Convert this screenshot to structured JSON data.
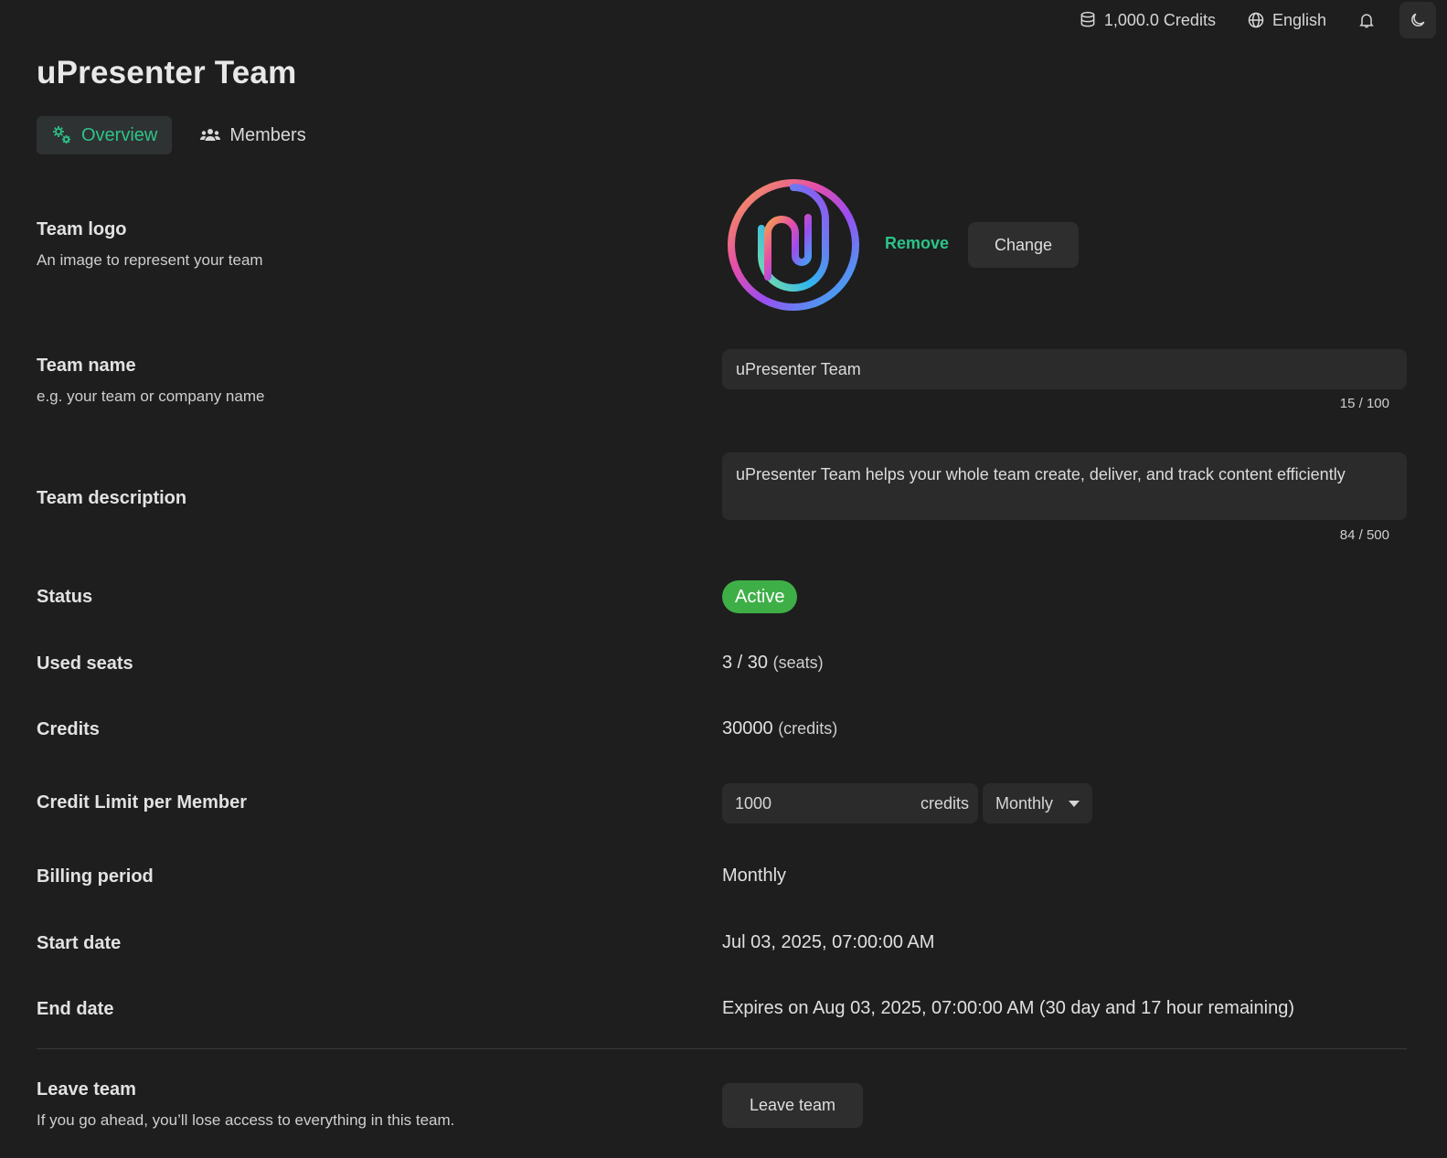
{
  "topbar": {
    "credits": "1,000.0 Credits",
    "language": "English"
  },
  "page_title": "uPresenter Team",
  "tabs": [
    {
      "label": "Overview",
      "active": true,
      "icon": "gears-icon"
    },
    {
      "label": "Members",
      "active": false,
      "icon": "users-icon"
    }
  ],
  "team_logo": {
    "title": "Team logo",
    "subtitle": "An image to represent your team",
    "remove_label": "Remove",
    "change_label": "Change"
  },
  "team_name": {
    "title": "Team name",
    "subtitle": "e.g. your team or company name",
    "value": "uPresenter Team",
    "counter": "15 / 100"
  },
  "team_description": {
    "title": "Team description",
    "value": "uPresenter Team helps your whole team create, deliver, and track content efficiently",
    "counter": "84 / 500"
  },
  "status": {
    "title": "Status",
    "value": "Active"
  },
  "used_seats": {
    "title": "Used seats",
    "value": "3 / 30",
    "unit": "(seats)"
  },
  "credits": {
    "title": "Credits",
    "value": "30000",
    "unit": "(credits)"
  },
  "credit_limit": {
    "title": "Credit Limit per Member",
    "value": "1000",
    "unit": "credits",
    "period": "Monthly"
  },
  "billing_period": {
    "title": "Billing period",
    "value": "Monthly"
  },
  "start_date": {
    "title": "Start date",
    "value": "Jul 03, 2025, 07:00:00 AM"
  },
  "end_date": {
    "title": "End date",
    "value": "Expires on Aug 03, 2025, 07:00:00 AM (30 day and 17 hour remaining)"
  },
  "leave_team": {
    "title": "Leave team",
    "subtitle": "If you go ahead, you’ll lose access to everything in this team.",
    "button_label": "Leave team"
  },
  "colors": {
    "accent": "#2cc38a",
    "active_badge": "#3eaf47",
    "background": "#1e1e1e"
  }
}
